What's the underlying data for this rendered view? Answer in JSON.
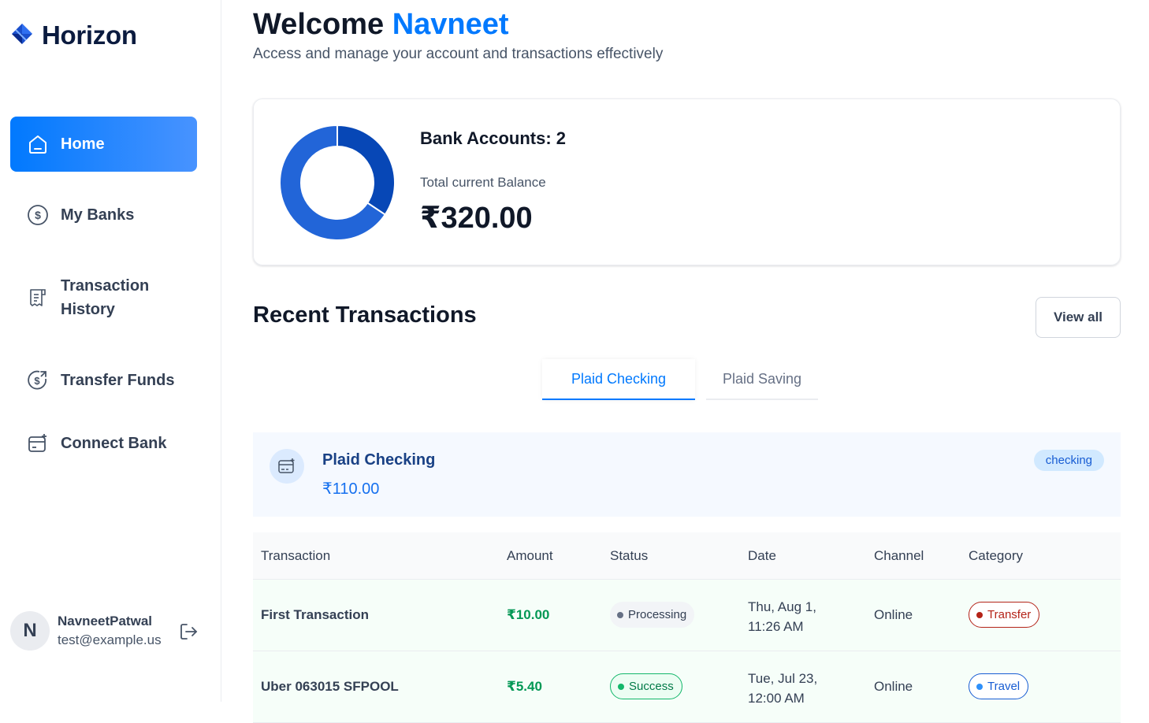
{
  "brand": {
    "title": "Horizon",
    "icon": "horizon-logo-icon"
  },
  "sidebar": {
    "items": [
      {
        "label": "Home",
        "icon": "home-icon",
        "active": true
      },
      {
        "label": "My Banks",
        "icon": "dollar-circle-icon"
      },
      {
        "label": "Transaction History",
        "label_line1": "Transaction",
        "label_line2": "History",
        "icon": "receipt-icon"
      },
      {
        "label": "Transfer Funds",
        "icon": "money-send-icon"
      },
      {
        "label": "Connect Bank",
        "icon": "connect-bank-icon"
      }
    ],
    "user": {
      "initial": "N",
      "name": "NavneetPatwal",
      "email": "test@example.us",
      "logout_icon": "logout-icon"
    }
  },
  "header": {
    "welcome": "Welcome",
    "name": "Navneet",
    "subtitle": "Access and manage your account and transactions effectively"
  },
  "balance": {
    "bank_accounts": "Bank Accounts: 2",
    "total_label": "Total current Balance",
    "total_value": "₹320.00",
    "donut": {
      "segments": [
        {
          "value": 110,
          "color": "#0747b6"
        },
        {
          "value": 210,
          "color": "#2265d8"
        }
      ]
    }
  },
  "recent": {
    "title": "Recent Transactions",
    "view_all": "View all",
    "tabs": [
      {
        "label": "Plaid Checking",
        "active": true
      },
      {
        "label": "Plaid Saving",
        "active": false
      }
    ],
    "bank": {
      "name": "Plaid Checking",
      "amount": "₹110.00",
      "type": "checking",
      "icon": "credit-card-icon"
    },
    "columns": [
      "Transaction",
      "Amount",
      "Status",
      "Date",
      "Channel",
      "Category"
    ],
    "rows": [
      {
        "name": "First Transaction",
        "amount": "₹10.00",
        "status": "Processing",
        "date_line1": "Thu, Aug 1,",
        "date_line2": "11:26 AM",
        "channel": "Online",
        "category": "Transfer"
      },
      {
        "name": "Uber 063015 SFPOOL",
        "amount": "₹5.40",
        "status": "Success",
        "date_line1": "Tue, Jul 23,",
        "date_line2": "12:00 AM",
        "channel": "Online",
        "category": "Travel"
      }
    ]
  },
  "colors": {
    "accent": "#0179fe",
    "sidebar_active_start": "#0179fe",
    "sidebar_active_end": "#4893ff",
    "success": "#12b76a",
    "transfer": "#b42318",
    "travel": "#175cd3"
  }
}
